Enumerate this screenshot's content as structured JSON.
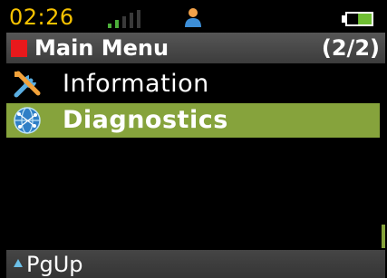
{
  "status_bar": {
    "time": "02:26",
    "signal_bars": 5,
    "signal_bars_lit": 2,
    "user_icon": "person-icon",
    "battery_level": 0.55
  },
  "title_bar": {
    "title": "Main Menu",
    "page": "(2/2)",
    "accent_color": "#e8191c"
  },
  "menu": {
    "items": [
      {
        "label": "Information",
        "icon": "tools-icon",
        "selected": false
      },
      {
        "label": "Diagnostics",
        "icon": "globe-network-icon",
        "selected": true
      }
    ],
    "selected_color": "#86a33c"
  },
  "softkeys": {
    "left_label": "PgUp",
    "left_icon": "up-arrow-icon"
  },
  "colors": {
    "clock": "#f7c200",
    "background": "#000000",
    "battery": "#6fbe33"
  }
}
